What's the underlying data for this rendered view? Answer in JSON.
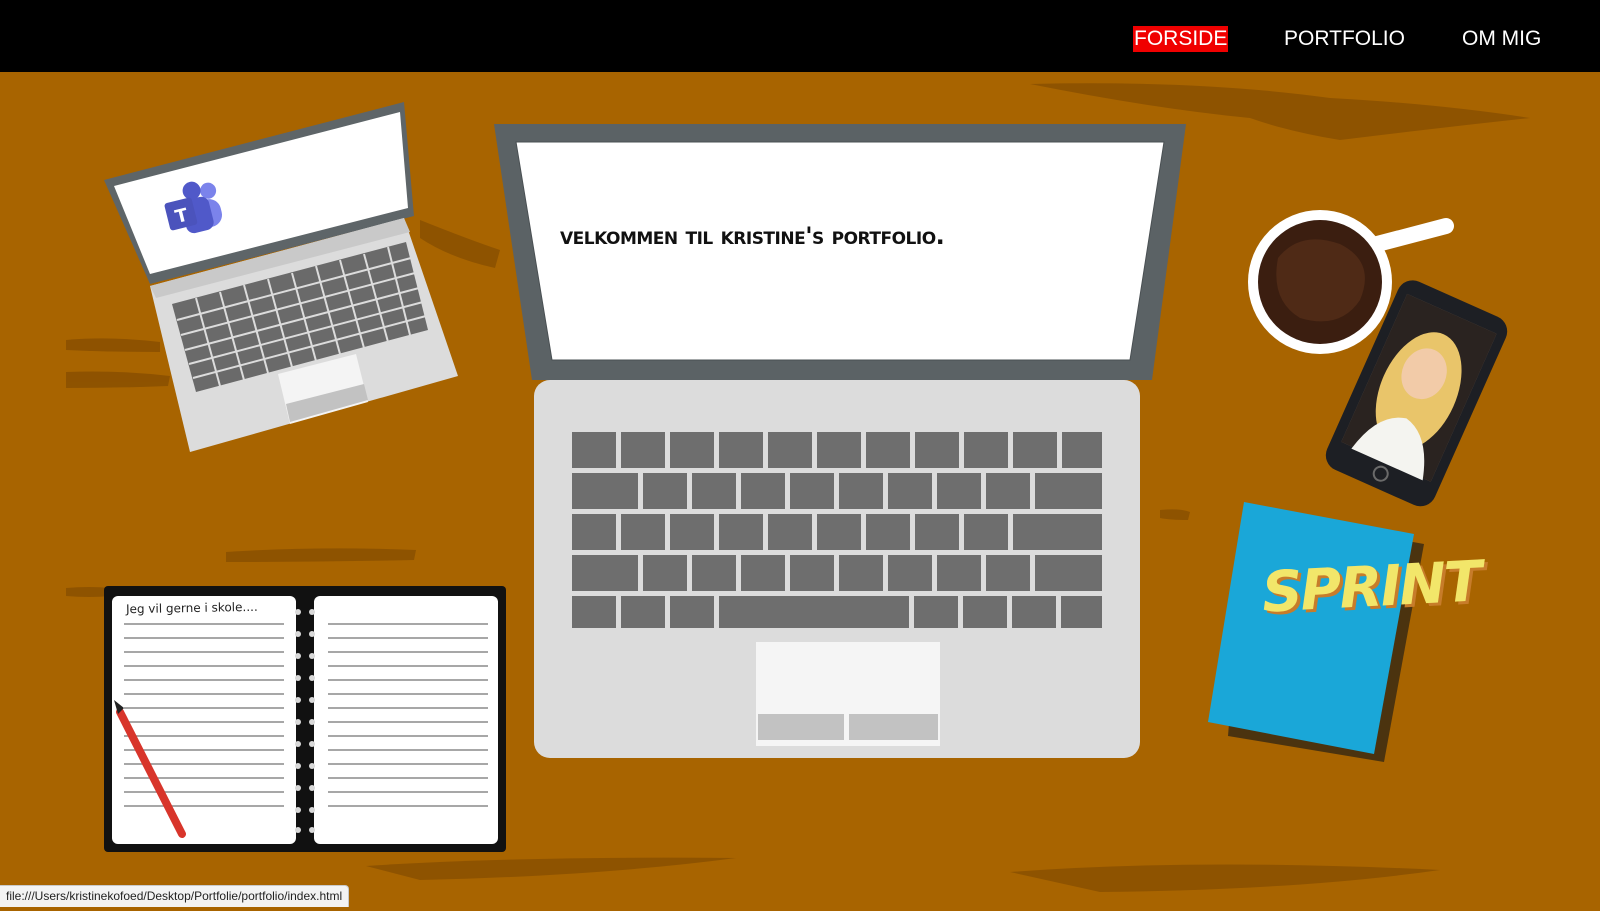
{
  "nav": {
    "items": [
      {
        "label": "FORSIDE",
        "active": true
      },
      {
        "label": "PORTFOLIO",
        "active": false
      },
      {
        "label": "OM MIG",
        "active": false
      }
    ]
  },
  "main_laptop": {
    "welcome_text": "Velkommen til Kristine's portfolio."
  },
  "notebook": {
    "text": "Jeg vil gerne i skole...."
  },
  "book": {
    "title": "SPRINT"
  },
  "status_bar": {
    "url": "file:///Users/kristinekofoed/Desktop/Portfolie/portfolio/index.html"
  },
  "colors": {
    "desk": "#a86400",
    "nav_bg": "#000000",
    "active_nav": "#f00000",
    "book_cover": "#1aa7d8"
  },
  "icons": [
    "teams-icon",
    "coffee-cup-icon",
    "phone-photo",
    "pencil-icon"
  ]
}
